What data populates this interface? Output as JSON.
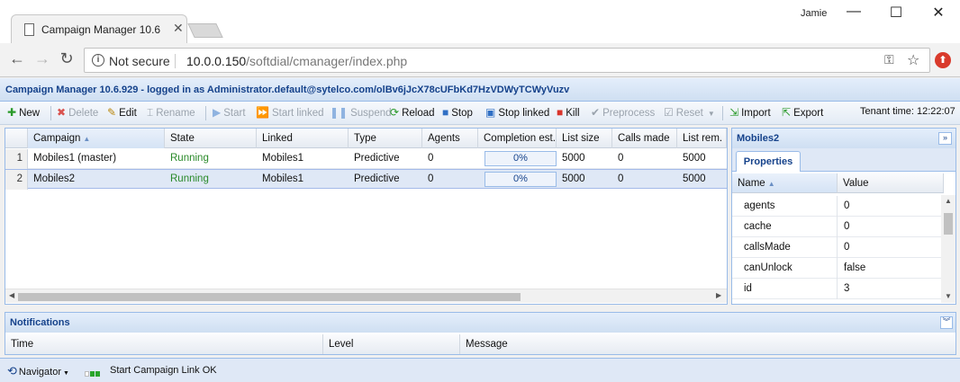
{
  "browser": {
    "tab_title": "Campaign Manager 10.6",
    "user": "Jamie",
    "security_label": "Not secure",
    "url_host": "10.0.0.150",
    "url_path": "/softdial/cmanager/index.php"
  },
  "app": {
    "title": "Campaign Manager 10.6.929 - logged in as Administrator.default@sytelco.com/olBv6jJcX78cUFbKd7HzVDWyTCWyVuzv"
  },
  "toolbar": {
    "new": "New",
    "delete": "Delete",
    "edit": "Edit",
    "rename": "Rename",
    "start": "Start",
    "start_linked": "Start linked",
    "suspend": "Suspend",
    "reload": "Reload",
    "stop": "Stop",
    "stop_linked": "Stop linked",
    "kill": "Kill",
    "preprocess": "Preprocess",
    "reset": "Reset",
    "import": "Import",
    "export": "Export",
    "tenant_time": "Tenant time:  12:22:07"
  },
  "grid": {
    "columns": [
      "Campaign",
      "State",
      "Linked",
      "Type",
      "Agents",
      "Completion est.",
      "List size",
      "Calls made",
      "List rem."
    ],
    "sorted_column": "Campaign",
    "rows": [
      {
        "num": "1",
        "campaign": "Mobiles1 (master)",
        "state": "Running",
        "linked": "Mobiles1",
        "type": "Predictive",
        "agents": "0",
        "completion": "0%",
        "completion_value": 0,
        "list_size": "5000",
        "calls_made": "0",
        "list_rem": "5000"
      },
      {
        "num": "2",
        "campaign": "Mobiles2",
        "state": "Running",
        "linked": "Mobiles1",
        "type": "Predictive",
        "agents": "0",
        "completion": "0%",
        "completion_value": 0,
        "list_size": "5000",
        "calls_made": "0",
        "list_rem": "5000"
      }
    ],
    "selected_row": 1
  },
  "properties": {
    "panel_title": "Mobiles2",
    "tab_label": "Properties",
    "columns": [
      "Name",
      "Value"
    ],
    "rows": [
      {
        "name": "agents",
        "value": "0"
      },
      {
        "name": "cache",
        "value": "0"
      },
      {
        "name": "callsMade",
        "value": "0"
      },
      {
        "name": "canUnlock",
        "value": "false"
      },
      {
        "name": "id",
        "value": "3"
      }
    ]
  },
  "notifications": {
    "title": "Notifications",
    "columns": [
      "Time",
      "Level",
      "Message"
    ]
  },
  "statusbar": {
    "navigator": "Navigator",
    "status_text": "Start Campaign Link OK"
  },
  "colors": {
    "accent": "#15428b",
    "panel_border": "#99bbe8",
    "running": "#2a8a2a"
  }
}
